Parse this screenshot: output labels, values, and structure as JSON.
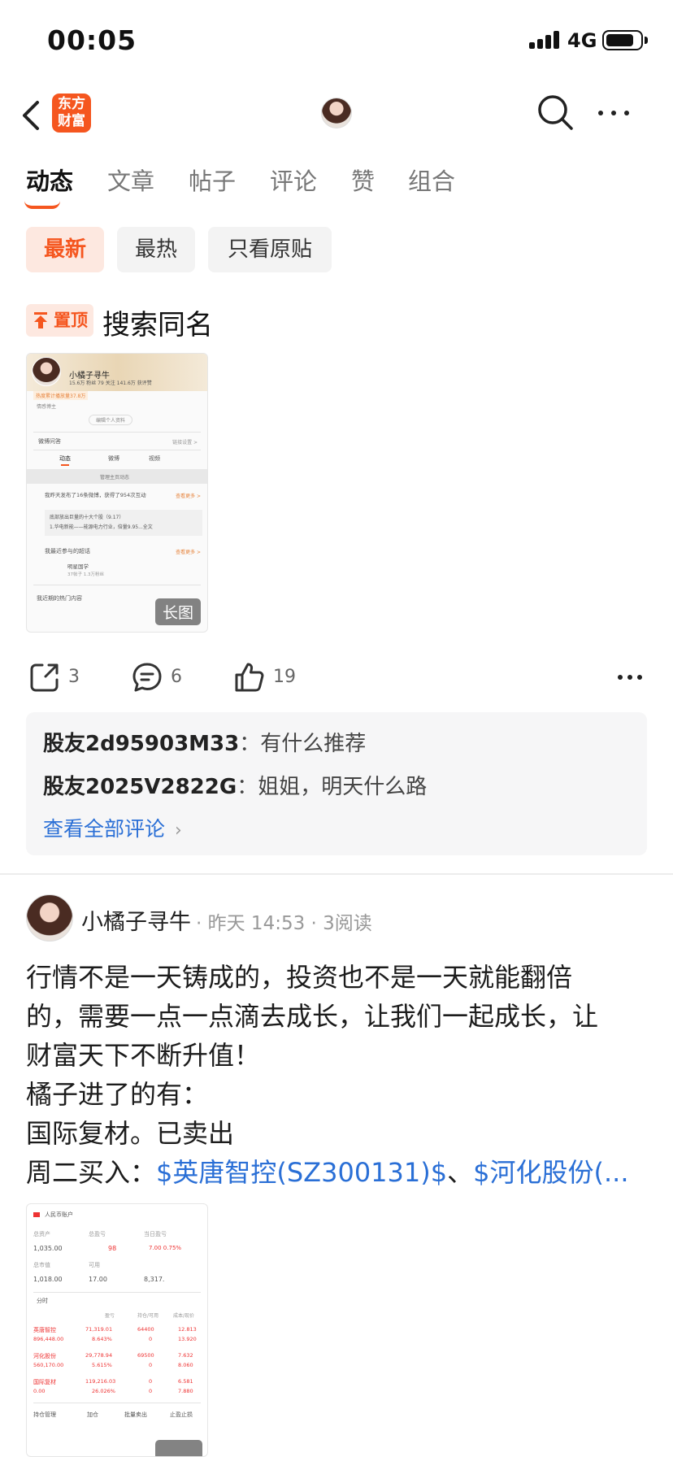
{
  "status_bar": {
    "time": "00:05",
    "network": "4G"
  },
  "tabs": [
    {
      "label": "动态"
    },
    {
      "label": "文章"
    },
    {
      "label": "帖子"
    },
    {
      "label": "评论"
    },
    {
      "label": "赞"
    },
    {
      "label": "组合"
    }
  ],
  "filters": [
    {
      "label": "最新"
    },
    {
      "label": "最热"
    },
    {
      "label": "只看原贴"
    }
  ],
  "pinned_post": {
    "badge": "置顶",
    "title": "搜索同名",
    "image_badge": "长图",
    "share_count": "3",
    "comment_count": "6",
    "like_count": "19",
    "comments": [
      {
        "user": "股友2d95903M33",
        "sep": "：",
        "text": "有什么推荐"
      },
      {
        "user": "股友2025V2822G",
        "sep": "：",
        "text": "姐姐，明天什么路"
      }
    ],
    "view_all": "查看全部评论"
  },
  "thumb1": {
    "name": "小橘子寻牛",
    "stats": "15.6万 粉丝   79 关注   141.6万 获评赞",
    "tag": "热度累计播放量37.8万",
    "bio": "情感博主",
    "edit": "编辑个人资料",
    "qa": "微博问答",
    "qa_right": "链接设置 >",
    "tab_a": "动态",
    "tab_b": "微博",
    "tab_c": "视频",
    "manage": "管理主页动态",
    "recent": "我昨天发布了16条微博，获得了954次互动",
    "recent_more": "查看更多 >",
    "quote1": "底部放出巨量的十大个股（9.17）",
    "quote2": "1.华电新能——能源电力行业，倍量9.95...全文",
    "topic": "我最近参与的超话",
    "topic_more": "查看更多 >",
    "topic_name": "明星国学",
    "topic_sub": "37帖子 1.3万粉丝",
    "hot": "我近期的热门内容"
  },
  "second_post": {
    "author": "小橘子寻牛",
    "meta": "· 昨天 14:53 · 3阅读",
    "line1": "行情不是一天铸成的，投资也不是一天就能翻倍",
    "line2": "的，需要一点一点滴去成长，让我们一起成长，让",
    "line3": "财富天下不断升值！",
    "line4": "橘子进了的有：",
    "line5": "国际复材。已卖出",
    "line6_prefix": "周二买入：",
    "stock1": "$英唐智控(SZ300131)$",
    "sep": "、",
    "stock2": "$河化股份(..."
  },
  "thumb2": {
    "header": "人民币账户",
    "r1c1": "总资产",
    "r1c2": "总盈亏",
    "r1c3": "当日盈亏",
    "r2c1": "1,035.00",
    "r2c2": "98",
    "r2c3": "7.00 0.75%",
    "r3c1": "总市值",
    "r3c2": "可用",
    "r4c1": "1,018.00",
    "r4c2": "17.00",
    "r4c3": "8,317.",
    "section": "分时",
    "h1": "盈亏",
    "h2": "持仓/可用",
    "h3": "成本/现价",
    "s1": "英唐智控",
    "s1a": "71,319.01",
    "s1b": "64400",
    "s1c": "12.813",
    "s1d": "896,448.00",
    "s1e": "8.643%",
    "s1f": "0",
    "s1g": "13.920",
    "s2": "河化股份",
    "s2a": "29,778.94",
    "s2b": "69500",
    "s2c": "7.632",
    "s2d": "560,170.00",
    "s2e": "5.615%",
    "s2f": "0",
    "s2g": "8.060",
    "s3": "国际复材",
    "s3a": "119,216.03",
    "s3b": "0",
    "s3c": "6.581",
    "s3d": "0.00",
    "s3e": "26.026%",
    "s3f": "0",
    "s3g": "7.880",
    "b1": "持仓管理",
    "b2": "加仓",
    "b3": "批量卖出",
    "b4": "止盈止损"
  }
}
